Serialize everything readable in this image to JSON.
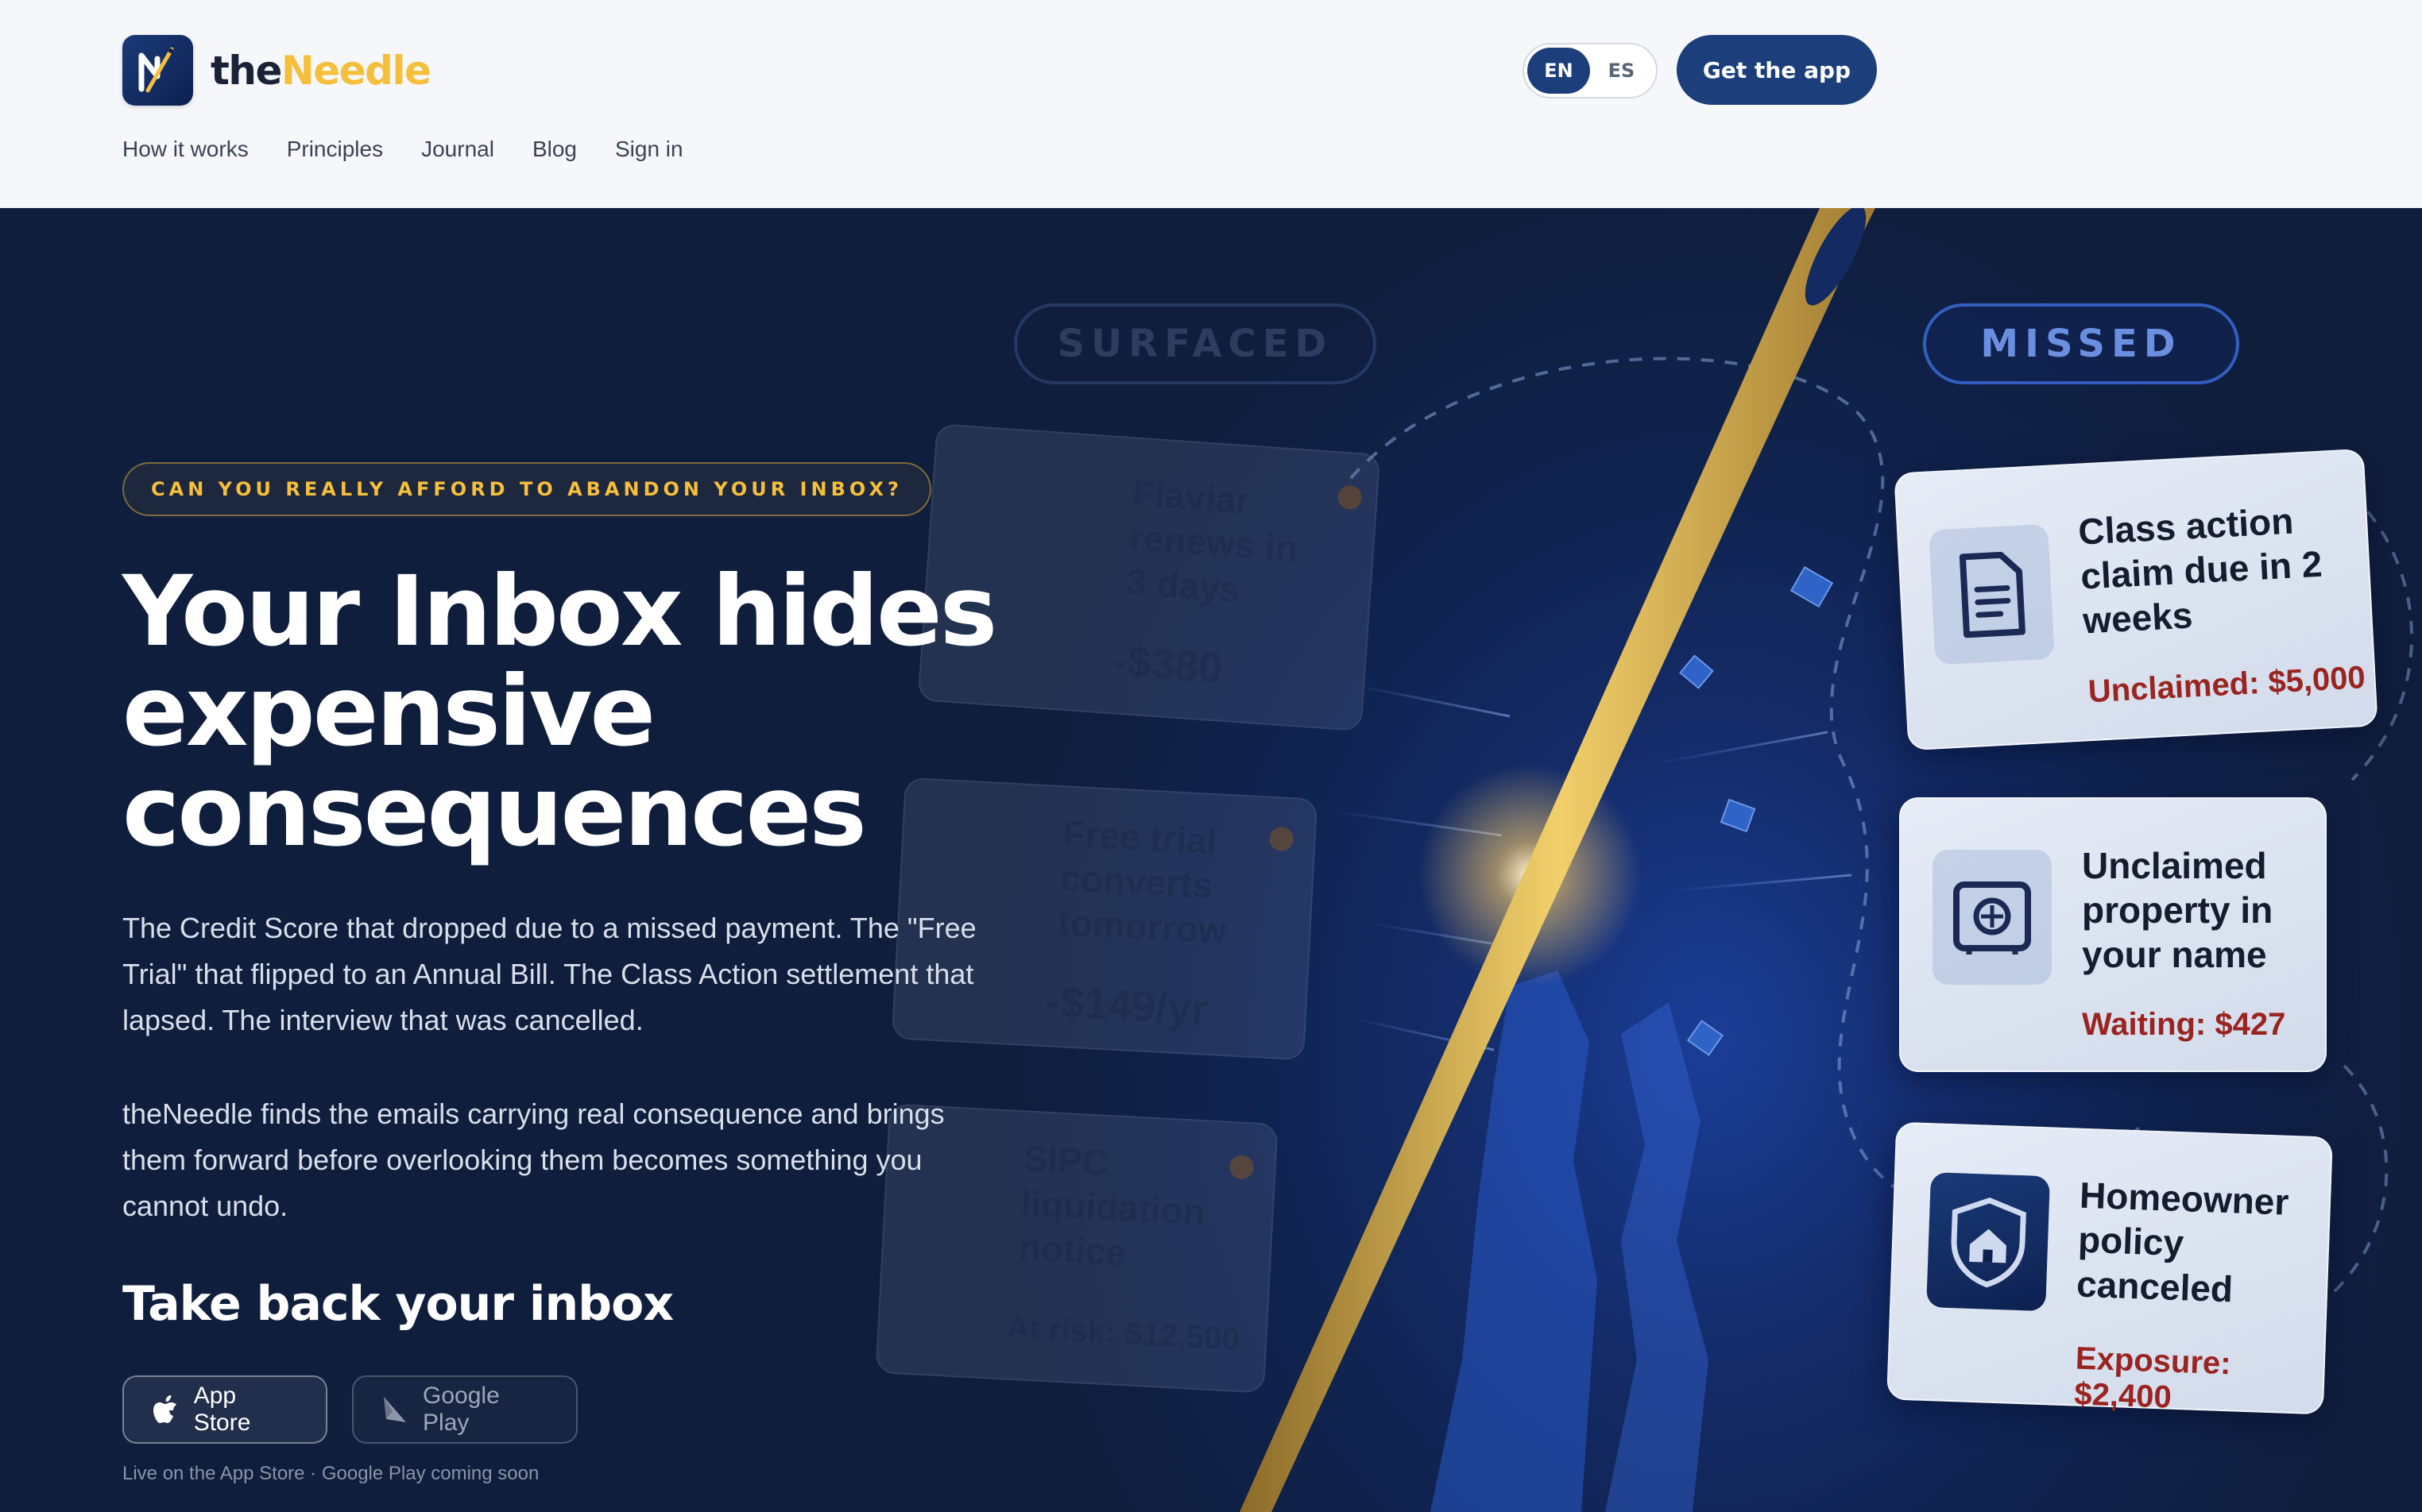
{
  "brand": {
    "name_prefix": "the",
    "name_suffix": "Needle",
    "accent": "#f5bf3c",
    "primary": "#1c3f7c"
  },
  "lang": {
    "options": [
      "EN",
      "ES"
    ],
    "selected": "EN"
  },
  "header": {
    "cta_label": "Get the app"
  },
  "nav": {
    "items": [
      "How it works",
      "Principles",
      "Journal",
      "Blog",
      "Sign in"
    ]
  },
  "hero": {
    "eyebrow": "CAN YOU REALLY AFFORD TO ABANDON YOUR INBOX?",
    "headline": "Your Inbox hides expensive consequences",
    "paragraph1": "The Credit Score that dropped due to a missed payment. The \"Free Trial\" that flipped to an Annual Bill.  The Class Action settlement that lapsed.  The interview that was cancelled.",
    "paragraph2": "theNeedle finds the emails carrying real consequence and brings them forward before overlooking them becomes something you cannot undo.",
    "subhead": "Take back your inbox",
    "store_apple": "App Store",
    "store_google": "Google Play",
    "footnote": "Live on the App Store · Google Play coming soon"
  },
  "illustration": {
    "badge_surfaced": "SURFACED",
    "badge_missed": "MISSED",
    "surfaced_cards": [
      {
        "title": "Flaviar renews in 3 days",
        "value": "-$380"
      },
      {
        "title": "Free trial converts tomorrow",
        "value": "-$149/yr"
      },
      {
        "title": "SIPC liquidation notice",
        "value": "At risk: $12,500"
      }
    ],
    "missed_cards": [
      {
        "title": "Class action claim due in 2 weeks",
        "value": "Unclaimed: $5,000",
        "icon": "document-icon"
      },
      {
        "title": "Unclaimed property in your name",
        "value": "Waiting: $427",
        "icon": "safe-icon"
      },
      {
        "title": "Homeowner policy canceled",
        "value": "Exposure: $2,400",
        "icon": "house-shield-icon"
      }
    ]
  }
}
